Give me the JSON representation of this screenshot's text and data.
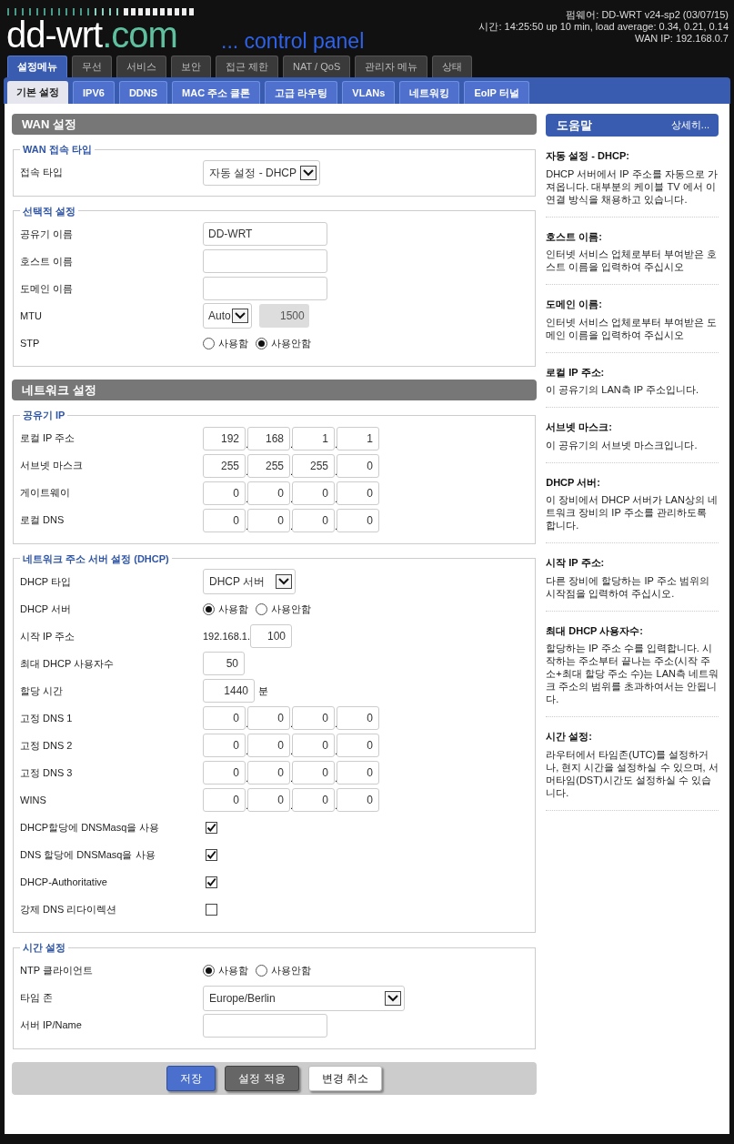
{
  "header": {
    "logo": "dd-wrt",
    "logo_suffix": ".com",
    "tagline": "... control panel",
    "info": [
      "펌웨어: DD-WRT v24-sp2 (03/07/15)",
      "시간: 14:25:50 up 10 min, load average: 0.34, 0.21, 0.14",
      "WAN IP: 192.168.0.7"
    ]
  },
  "tabs": [
    {
      "label": "설정메뉴",
      "selected": true
    },
    {
      "label": "무선",
      "selected": false
    },
    {
      "label": "서비스",
      "selected": false
    },
    {
      "label": "보안",
      "selected": false
    },
    {
      "label": "접근 제한",
      "selected": false
    },
    {
      "label": "NAT / QoS",
      "selected": false
    },
    {
      "label": "관리자 메뉴",
      "selected": false
    },
    {
      "label": "상태",
      "selected": false
    }
  ],
  "subtabs": [
    {
      "label": "기본 설정",
      "selected": true
    },
    {
      "label": "IPV6",
      "selected": false
    },
    {
      "label": "DDNS",
      "selected": false
    },
    {
      "label": "MAC 주소 클론",
      "selected": false
    },
    {
      "label": "고급 라우팅",
      "selected": false
    },
    {
      "label": "VLANs",
      "selected": false
    },
    {
      "label": "네트워킹",
      "selected": false
    },
    {
      "label": "EoIP 터널",
      "selected": false
    }
  ],
  "ip_separator": ".",
  "sections": [
    {
      "title": "WAN 설정",
      "groups": [
        {
          "legend": "WAN 접속 타입",
          "rows": [
            {
              "kind": "select",
              "label": "접속 타입",
              "value": "자동 설정 - DHCP"
            }
          ]
        },
        {
          "legend": "선택적 설정",
          "rows": [
            {
              "kind": "text",
              "label": "공유기 이름",
              "value": "DD-WRT"
            },
            {
              "kind": "text",
              "label": "호스트 이름"
            },
            {
              "kind": "text",
              "label": "도메인 이름"
            },
            {
              "kind": "mtu",
              "label": "MTU",
              "value": "Auto",
              "size": "1500"
            },
            {
              "kind": "radio",
              "label": "STP",
              "options": [
                {
                  "label": "사용함",
                  "selected": false
                },
                {
                  "label": "사용안함",
                  "selected": true
                }
              ]
            }
          ]
        }
      ]
    },
    {
      "title": "네트워크 설정",
      "groups": [
        {
          "legend": "공유기 IP",
          "rows": [
            {
              "kind": "ip",
              "label": "로컬 IP 주소",
              "octets": [
                "192",
                "168",
                "1",
                "1"
              ]
            },
            {
              "kind": "ip",
              "label": "서브넷 마스크",
              "octets": [
                "255",
                "255",
                "255",
                "0"
              ]
            },
            {
              "kind": "ip",
              "label": "게이트웨이",
              "octets": [
                "0",
                "0",
                "0",
                "0"
              ]
            },
            {
              "kind": "ip",
              "label": "로컬 DNS",
              "octets": [
                "0",
                "0",
                "0",
                "0"
              ]
            }
          ]
        },
        {
          "legend": "네트워크 주소 서버 설정 (DHCP)",
          "rows": [
            {
              "kind": "select",
              "label": "DHCP 타입",
              "value": "DHCP 서버"
            },
            {
              "kind": "radio",
              "label": "DHCP 서버",
              "options": [
                {
                  "label": "사용함",
                  "selected": true
                },
                {
                  "label": "사용안함",
                  "selected": false
                }
              ]
            },
            {
              "kind": "prefix",
              "label": "시작 IP 주소",
              "prefix": "192.168.1.",
              "value": "100"
            },
            {
              "kind": "number",
              "label": "최대 DHCP 사용자수",
              "value": "50"
            },
            {
              "kind": "number",
              "label": "할당 시간",
              "value": "1440",
              "unit": "분"
            },
            {
              "kind": "ip",
              "label": "고정 DNS 1",
              "octets": [
                "0",
                "0",
                "0",
                "0"
              ]
            },
            {
              "kind": "ip",
              "label": "고정 DNS 2",
              "octets": [
                "0",
                "0",
                "0",
                "0"
              ]
            },
            {
              "kind": "ip",
              "label": "고정 DNS 3",
              "octets": [
                "0",
                "0",
                "0",
                "0"
              ]
            },
            {
              "kind": "ip",
              "label": "WINS",
              "octets": [
                "0",
                "0",
                "0",
                "0"
              ]
            },
            {
              "kind": "checkbox",
              "label": "DHCP할당에 DNSMasq을 사용",
              "checked": true
            },
            {
              "kind": "checkbox",
              "label": "DNS 할당에 DNSMasq을 사용",
              "checked": true
            },
            {
              "kind": "checkbox",
              "label": "DHCP-Authoritative",
              "checked": true
            },
            {
              "kind": "checkbox",
              "label": "강제 DNS 리다이렉션",
              "checked": false
            }
          ]
        },
        {
          "legend": "시간 설정",
          "rows": [
            {
              "kind": "radio",
              "label": "NTP 클라이언트",
              "options": [
                {
                  "label": "사용함",
                  "selected": true
                },
                {
                  "label": "사용안함",
                  "selected": false
                }
              ]
            },
            {
              "kind": "wideselect",
              "label": "타임 존",
              "value": "Europe/Berlin"
            },
            {
              "kind": "text",
              "label": "서버 IP/Name"
            }
          ]
        }
      ]
    }
  ],
  "buttons": [
    {
      "label": "저장",
      "kind": "primary"
    },
    {
      "label": "설정 적용",
      "kind": "secondary"
    },
    {
      "label": "변경 취소",
      "kind": "plain"
    }
  ],
  "help": {
    "title": "도움말",
    "more": "상세히...",
    "items": [
      {
        "heading": "자동 설정 - DHCP:",
        "text": "DHCP 서버에서 IP 주소를 자동으로 가져옵니다. 대부분의 케이블 TV 에서 이 연결 방식을 채용하고 있습니다."
      },
      {
        "heading": "호스트 이름:",
        "text": "인터넷 서비스 업체로부터 부여받은 호스트 이름을 입력하여 주십시오"
      },
      {
        "heading": "도메인 이름:",
        "text": "인터넷 서비스 업체로부터 부여받은 도메인 이름을 입력하여 주십시오"
      },
      {
        "heading": "로컬 IP 주소:",
        "text": "이 공유기의 LAN측 IP 주소입니다."
      },
      {
        "heading": "서브넷 마스크:",
        "text": "이 공유기의 서브넷 마스크입니다."
      },
      {
        "heading": "DHCP 서버:",
        "text": "이 장비에서 DHCP 서버가 LAN상의 네트워크 장비의 IP 주소를 관리하도록 합니다."
      },
      {
        "heading": "시작 IP 주소:",
        "text": "다른 장비에 할당하는 IP 주소 범위의 시작점을 입력하여 주십시오."
      },
      {
        "heading": "최대 DHCP 사용자수:",
        "text": "할당하는 IP 주소 수를 입력합니다. 시작하는 주소부터 끝나는 주소(시작 주소+최대 할당 주소 수)는 LAN측 네트워크 주소의 범위를 초과하여서는 안됩니다."
      },
      {
        "heading": "시간 설정:",
        "text": "라우터에서 타임존(UTC)를 설정하거나, 현지 시간을 설정하실 수 있으며, 서머타임(DST)시간도 설정하실 수 있습니다."
      }
    ]
  }
}
